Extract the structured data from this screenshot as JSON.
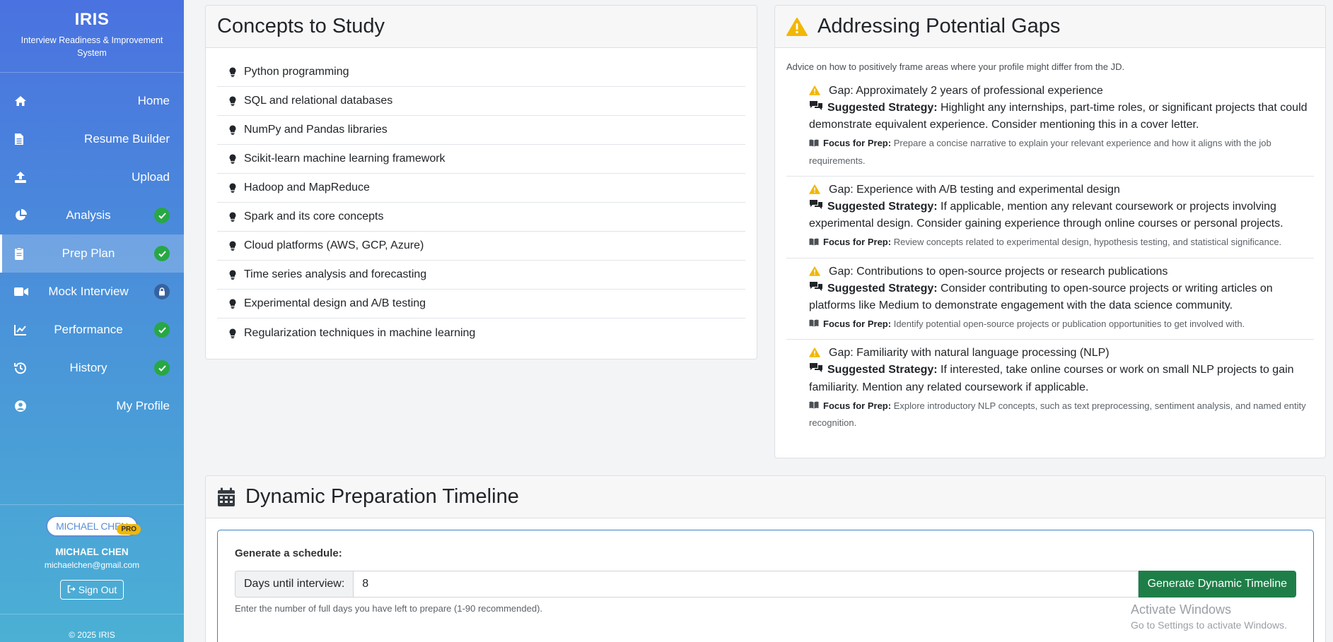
{
  "sidebar": {
    "brand": "IRIS",
    "subtitle": "Interview Readiness & Improvement System",
    "items": [
      {
        "label": "Home",
        "icon": "home-icon",
        "status": ""
      },
      {
        "label": "Resume Builder",
        "icon": "file-icon",
        "status": ""
      },
      {
        "label": "Upload",
        "icon": "upload-icon",
        "status": ""
      },
      {
        "label": "Analysis",
        "icon": "pie-chart-icon",
        "status": "complete"
      },
      {
        "label": "Prep Plan",
        "icon": "clipboard-icon",
        "status": "complete",
        "active": true
      },
      {
        "label": "Mock Interview",
        "icon": "video-icon",
        "status": "locked"
      },
      {
        "label": "Performance",
        "icon": "line-chart-icon",
        "status": "complete"
      },
      {
        "label": "History",
        "icon": "history-icon",
        "status": "complete"
      },
      {
        "label": "My Profile",
        "icon": "user-circle-icon",
        "status": ""
      }
    ],
    "profile": {
      "avatar_text": "MICHAEL CHEN",
      "badge": "PRO",
      "name": "MICHAEL CHEN",
      "email": "michaelchen@gmail.com",
      "sign_out": "Sign Out",
      "copyright": "© 2025 IRIS"
    }
  },
  "concepts": {
    "title": "Concepts to Study",
    "items": [
      "Python programming",
      "SQL and relational databases",
      "NumPy and Pandas libraries",
      "Scikit-learn machine learning framework",
      "Hadoop and MapReduce",
      "Spark and its core concepts",
      "Cloud platforms (AWS, GCP, Azure)",
      "Time series analysis and forecasting",
      "Experimental design and A/B testing",
      "Regularization techniques in machine learning"
    ]
  },
  "gaps": {
    "title": "Addressing Potential Gaps",
    "intro": "Advice on how to positively frame areas where your profile might differ from the JD.",
    "strategy_label": "Suggested Strategy:",
    "prep_label": "Focus for Prep:",
    "items": [
      {
        "title": "Gap: Approximately 2 years of professional experience",
        "strategy": "Highlight any internships, part-time roles, or significant projects that could demonstrate equivalent experience. Consider mentioning this in a cover letter.",
        "prep": "Prepare a concise narrative to explain your relevant experience and how it aligns with the job requirements."
      },
      {
        "title": "Gap: Experience with A/B testing and experimental design",
        "strategy": "If applicable, mention any relevant coursework or projects involving experimental design. Consider gaining experience through online courses or personal projects.",
        "prep": "Review concepts related to experimental design, hypothesis testing, and statistical significance."
      },
      {
        "title": "Gap: Contributions to open-source projects or research publications",
        "strategy": "Consider contributing to open-source projects or writing articles on platforms like Medium to demonstrate engagement with the data science community.",
        "prep": "Identify potential open-source projects or publication opportunities to get involved with."
      },
      {
        "title": "Gap: Familiarity with natural language processing (NLP)",
        "strategy": "If interested, take online courses or work on small NLP projects to gain familiarity. Mention any related coursework if applicable.",
        "prep": "Explore introductory NLP concepts, such as text preprocessing, sentiment analysis, and named entity recognition."
      }
    ]
  },
  "timeline": {
    "title": "Dynamic Preparation Timeline",
    "schedule_label": "Generate a schedule:",
    "days_label": "Days until interview:",
    "days_value": "8",
    "button": "Generate Dynamic Timeline",
    "hint": "Enter the number of full days you have left to prepare (1-90 recommended)."
  },
  "watermark": {
    "title": "Activate Windows",
    "subtitle": "Go to Settings to activate Windows."
  },
  "colors": {
    "sidebar_top": "#4a72e0",
    "sidebar_bottom": "#4bb0d4",
    "success": "#28a745",
    "warning": "#f2b705",
    "button": "#1e7e48",
    "input_border_focus": "#3b82c4"
  }
}
